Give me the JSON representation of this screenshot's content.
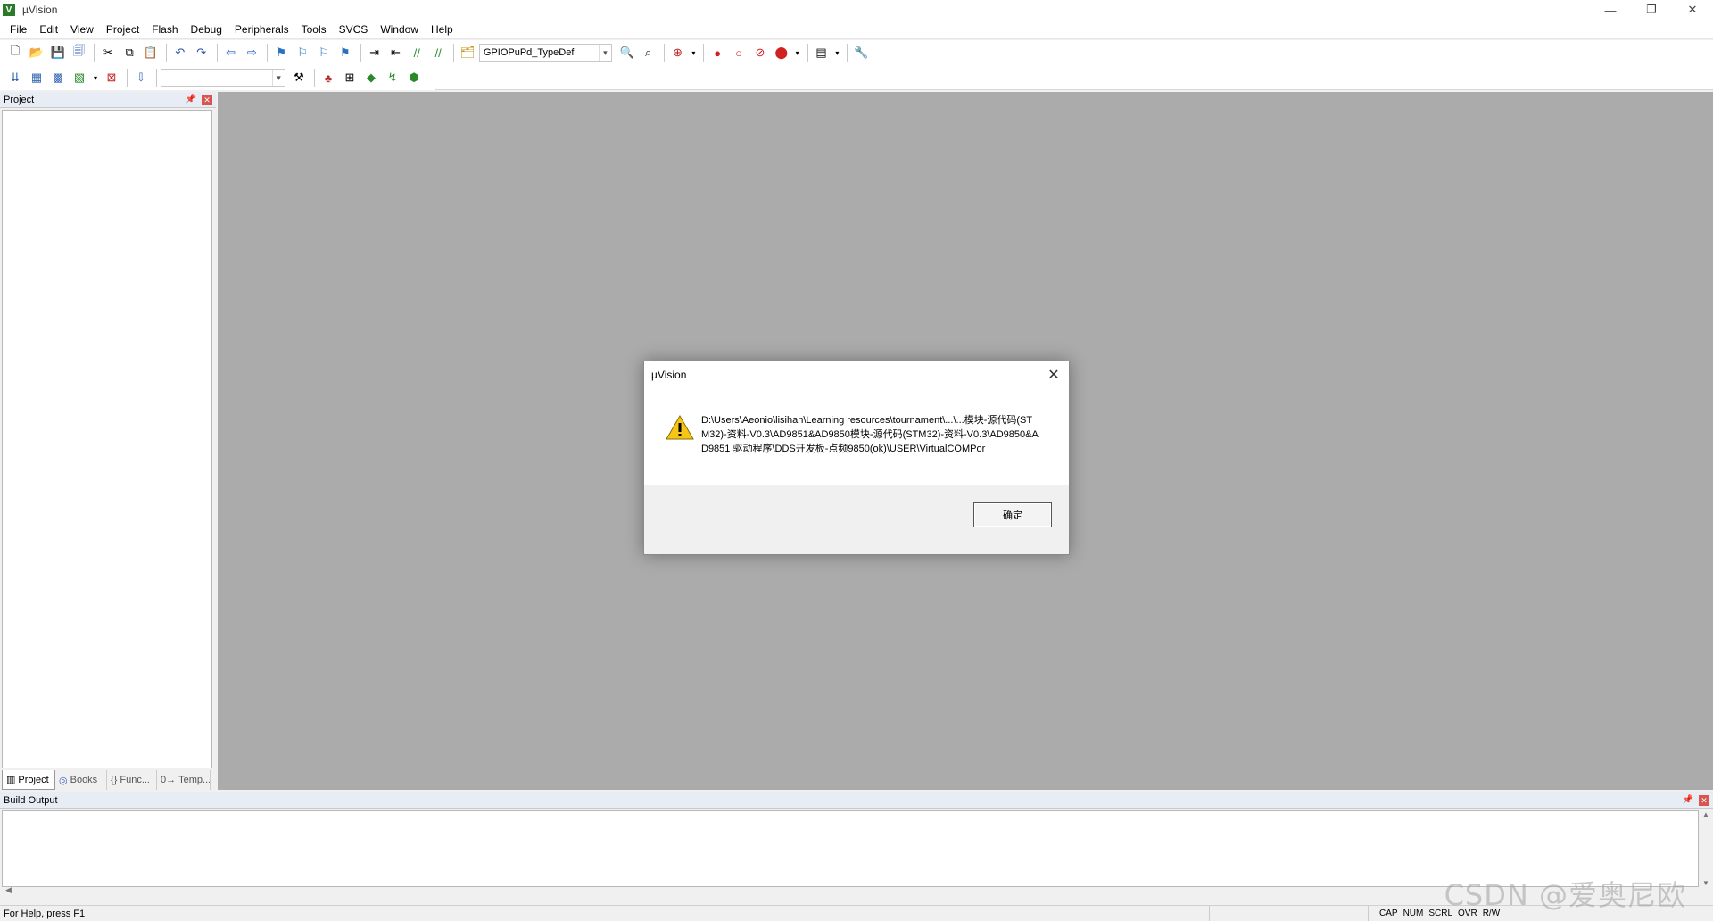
{
  "window": {
    "title": "µVision",
    "minimize": "—",
    "restore": "❐",
    "close": "✕"
  },
  "menu": [
    "File",
    "Edit",
    "View",
    "Project",
    "Flash",
    "Debug",
    "Peripherals",
    "Tools",
    "SVCS",
    "Window",
    "Help"
  ],
  "toolbar": {
    "find_combo_value": "GPIOPuPd_TypeDef",
    "target_combo_value": ""
  },
  "project_panel": {
    "title": "Project",
    "tabs": [
      {
        "label": "Project",
        "icon": "project-icon"
      },
      {
        "label": "Books",
        "icon": "books-icon"
      },
      {
        "label": "Func...",
        "icon": "functions-icon"
      },
      {
        "label": "Temp...",
        "icon": "templates-icon"
      }
    ]
  },
  "build_output": {
    "title": "Build Output"
  },
  "dialog": {
    "title": "µVision",
    "message": "D:\\Users\\Aeonio\\lisihan\\Learning resources\\tournament\\...\\...模块-源代码(STM32)-资料-V0.3\\AD9851&AD9850模块-源代码(STM32)-资料-V0.3\\AD9850&AD9851 驱动程序\\DDS开发板-点频9850(ok)\\USER\\VirtualCOMPor",
    "ok_label": "确定"
  },
  "status": {
    "help": "For Help, press F1",
    "flags": [
      "CAP",
      "NUM",
      "SCRL",
      "OVR",
      "R/W"
    ]
  },
  "watermark": "CSDN @爱奥尼欧",
  "colors": {
    "mdi_background": "#ababab",
    "panel_header": "#e8ecf5",
    "close_red": "#d9534f"
  }
}
